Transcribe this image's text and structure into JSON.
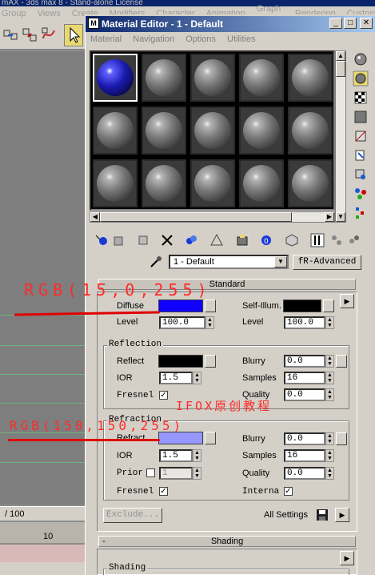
{
  "background_app": {
    "title": "mAX - 3ds max 8 - Stand-alone License",
    "menu": [
      "Group",
      "Views",
      "Create",
      "Modifiers",
      "Character",
      "Animation",
      "Graph Editors",
      "Rendering",
      "Custom"
    ],
    "time_readout": "/ 100",
    "ruler_tick": "10"
  },
  "material_editor": {
    "title": "Material Editor - 1 - Default",
    "menu": [
      "Material",
      "Navigation",
      "Options",
      "Utilities"
    ],
    "material_name": "1 - Default",
    "material_type": "fR-Advanced",
    "standard_header": "Standard",
    "diffuse_label": "Diffuse",
    "diffuse_color": "#0f00ff",
    "level_label": "Level",
    "level_value": "100.0",
    "self_illum_label": "Self-Illum.",
    "self_illum_color": "#000000",
    "self_illum_level_label": "Level",
    "self_illum_level_value": "100.0",
    "reflection": {
      "title": "Reflection",
      "reflect_label": "Reflect",
      "reflect_color": "#000000",
      "ior_label": "IOR",
      "ior_value": "1.5",
      "fresnel_label": "Fresnel",
      "fresnel_checked": true,
      "blurry_label": "Blurry",
      "blurry_value": "0.0",
      "samples_label": "Samples",
      "samples_value": "16",
      "quality_label": "Quality",
      "quality_value": "0.0"
    },
    "refraction": {
      "title": "Refraction",
      "refract_label": "Refract",
      "refract_color": "#9696ff",
      "ior_label": "IOR",
      "ior_value": "1.5",
      "prior_label": "Prior",
      "prior_value": "1",
      "fresnel_label": "Fresnel",
      "fresnel_checked": true,
      "blurry_label": "Blurry",
      "blurry_value": "0.0",
      "samples_label": "Samples",
      "samples_value": "16",
      "quality_label": "Quality",
      "quality_value": "0.0",
      "internal_label": "Interna",
      "internal_checked": true
    },
    "exclude_button": "Exclude...",
    "all_settings_label": "All Settings",
    "shading_header": "Shading",
    "shading_subheader": "Shading"
  },
  "annotations": {
    "diffuse_rgb": "RGB(15,0,255)",
    "refract_rgb": "RGB(150,150,255)",
    "watermark": "IFOX原创教程",
    "color": "#ff2b2b"
  }
}
